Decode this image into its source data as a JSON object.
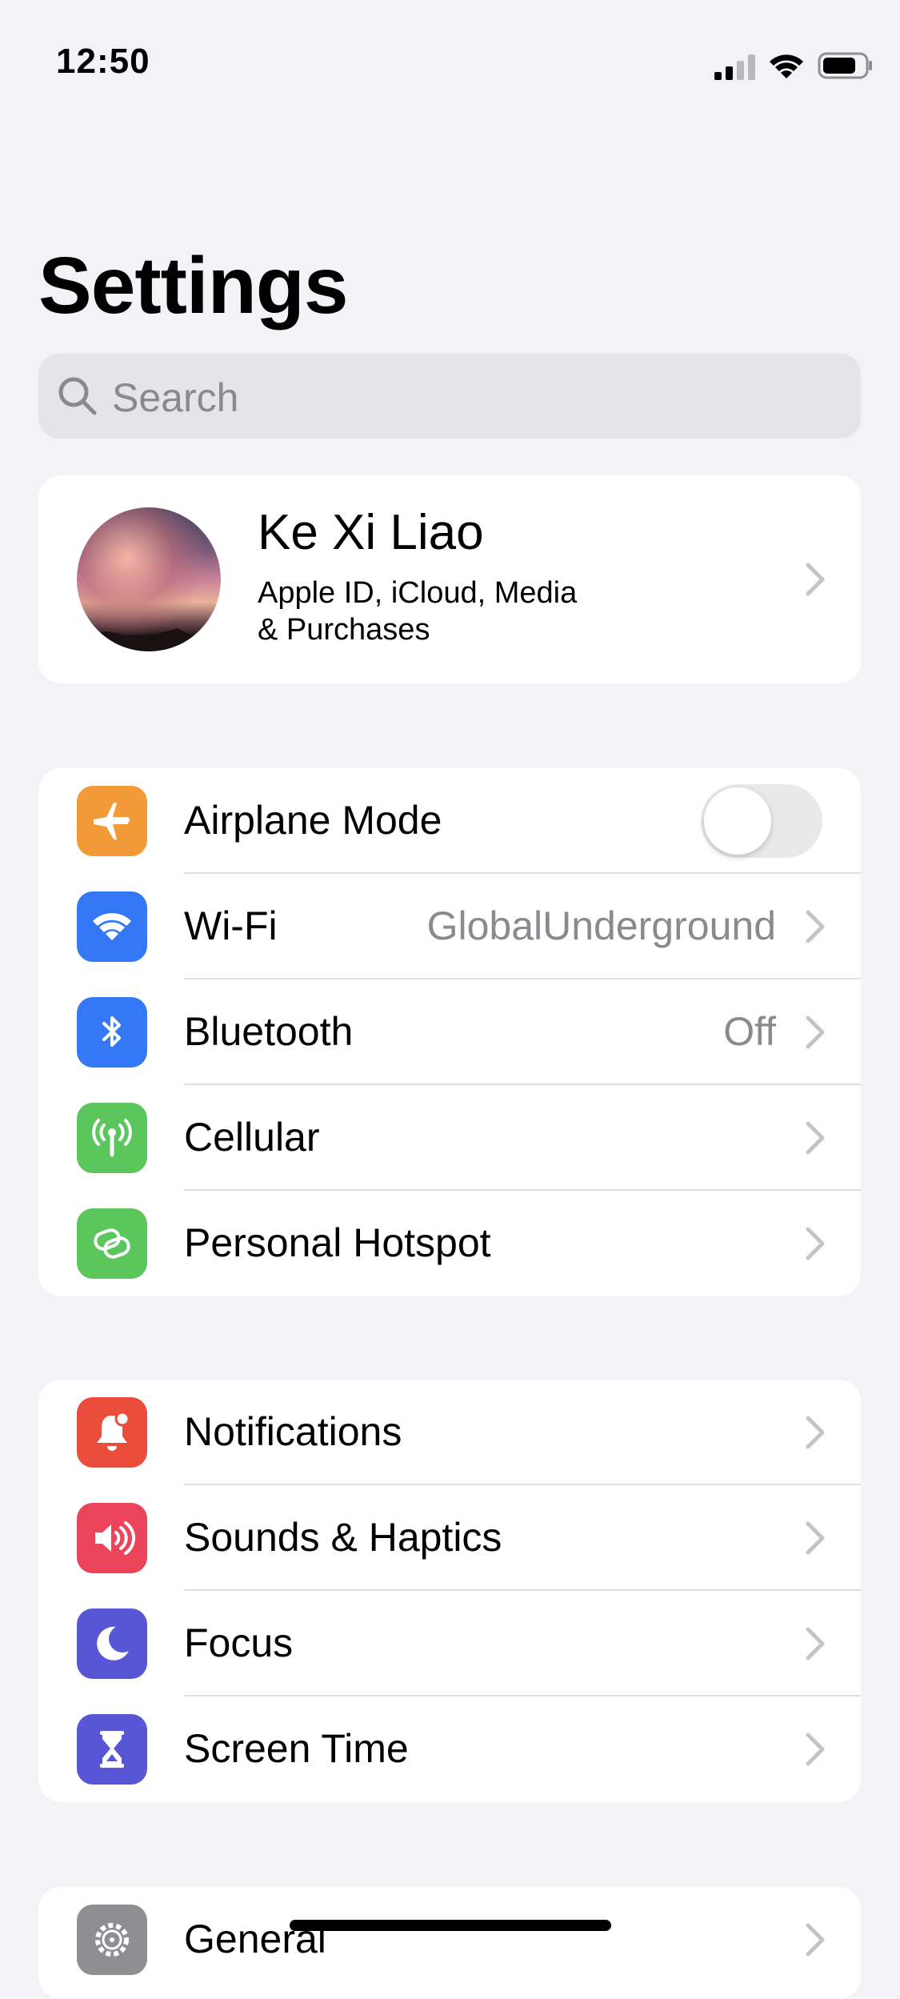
{
  "status_bar": {
    "time": "12:50"
  },
  "page": {
    "title": "Settings"
  },
  "search": {
    "placeholder": "Search"
  },
  "profile": {
    "name": "Ke Xi Liao",
    "subtitle_line1": "Apple ID, iCloud, Media",
    "subtitle_line2": "& Purchases"
  },
  "connectivity": {
    "airplane": {
      "label": "Airplane Mode",
      "icon": "airplane-icon",
      "color": "#f19a37",
      "toggle_on": false
    },
    "wifi": {
      "label": "Wi-Fi",
      "value": "GlobalUnderground",
      "icon": "wifi-icon",
      "color": "#3478f6"
    },
    "bluetooth": {
      "label": "Bluetooth",
      "value": "Off",
      "icon": "bluetooth-icon",
      "color": "#3478f6"
    },
    "cellular": {
      "label": "Cellular",
      "icon": "antenna-icon",
      "color": "#5ac65b"
    },
    "hotspot": {
      "label": "Personal Hotspot",
      "icon": "link-icon",
      "color": "#5ac65b"
    }
  },
  "notify_group": {
    "notifications": {
      "label": "Notifications",
      "icon": "bell-icon",
      "color": "#eb4d3d"
    },
    "sounds": {
      "label": "Sounds & Haptics",
      "icon": "speaker-icon",
      "color": "#eb445a"
    },
    "focus": {
      "label": "Focus",
      "icon": "moon-icon",
      "color": "#5856d6"
    },
    "screen_time": {
      "label": "Screen Time",
      "icon": "hourglass-icon",
      "color": "#5856d6"
    }
  },
  "general_group": {
    "general": {
      "label": "General",
      "icon": "gear-icon",
      "color": "#8e8e93"
    }
  }
}
